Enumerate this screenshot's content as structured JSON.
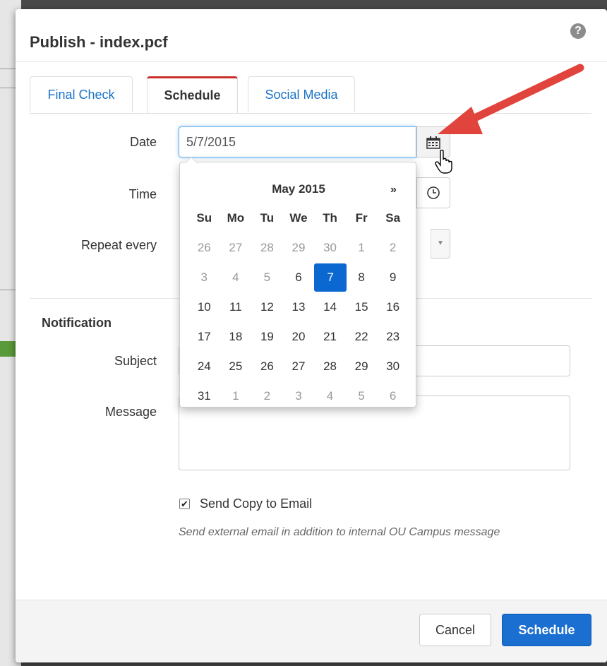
{
  "dialog": {
    "title": "Publish - index.pcf",
    "help_icon": "question-circle-icon"
  },
  "tabs": [
    {
      "label": "Final Check",
      "active": false
    },
    {
      "label": "Schedule",
      "active": true
    },
    {
      "label": "Social Media",
      "active": false
    }
  ],
  "schedule": {
    "date_label": "Date",
    "date_value": "5/7/2015",
    "calendar_icon": "calendar-icon",
    "time_label": "Time",
    "clock_icon": "clock-icon",
    "repeat_label": "Repeat every",
    "repeat_caret_icon": "caret-down-icon"
  },
  "datepicker": {
    "month_title": "May 2015",
    "next_label": "»",
    "weekdays": [
      "Su",
      "Mo",
      "Tu",
      "We",
      "Th",
      "Fr",
      "Sa"
    ],
    "weeks": [
      [
        {
          "d": "26",
          "m": true
        },
        {
          "d": "27",
          "m": true
        },
        {
          "d": "28",
          "m": true
        },
        {
          "d": "29",
          "m": true
        },
        {
          "d": "30",
          "m": true
        },
        {
          "d": "1",
          "m": true
        },
        {
          "d": "2",
          "m": true
        }
      ],
      [
        {
          "d": "3",
          "m": true
        },
        {
          "d": "4",
          "m": true
        },
        {
          "d": "5",
          "m": true
        },
        {
          "d": "6",
          "m": false
        },
        {
          "d": "7",
          "m": false,
          "active": true
        },
        {
          "d": "8",
          "m": false
        },
        {
          "d": "9",
          "m": false
        }
      ],
      [
        {
          "d": "10",
          "m": false
        },
        {
          "d": "11",
          "m": false
        },
        {
          "d": "12",
          "m": false
        },
        {
          "d": "13",
          "m": false
        },
        {
          "d": "14",
          "m": false
        },
        {
          "d": "15",
          "m": false
        },
        {
          "d": "16",
          "m": false
        }
      ],
      [
        {
          "d": "17",
          "m": false
        },
        {
          "d": "18",
          "m": false
        },
        {
          "d": "19",
          "m": false
        },
        {
          "d": "20",
          "m": false
        },
        {
          "d": "21",
          "m": false
        },
        {
          "d": "22",
          "m": false
        },
        {
          "d": "23",
          "m": false
        }
      ],
      [
        {
          "d": "24",
          "m": false
        },
        {
          "d": "25",
          "m": false
        },
        {
          "d": "26",
          "m": false
        },
        {
          "d": "27",
          "m": false
        },
        {
          "d": "28",
          "m": false
        },
        {
          "d": "29",
          "m": false
        },
        {
          "d": "30",
          "m": false
        }
      ],
      [
        {
          "d": "31",
          "m": false
        },
        {
          "d": "1",
          "m": true
        },
        {
          "d": "2",
          "m": true
        },
        {
          "d": "3",
          "m": true
        },
        {
          "d": "4",
          "m": true
        },
        {
          "d": "5",
          "m": true
        },
        {
          "d": "6",
          "m": true
        }
      ]
    ],
    "selected_color": "#0a68d0"
  },
  "notification": {
    "section_title": "Notification",
    "subject_label": "Subject",
    "subject_value": "",
    "message_label": "Message",
    "message_value": "",
    "send_copy_checked": true,
    "send_copy_label": "Send Copy to Email",
    "help_text": "Send external email in addition to internal OU Campus message"
  },
  "footer": {
    "cancel_label": "Cancel",
    "schedule_label": "Schedule",
    "primary_color": "#1a6fd0"
  },
  "annotation": {
    "arrow_color": "#e0443c",
    "cursor_icon": "hand-pointer-icon"
  }
}
